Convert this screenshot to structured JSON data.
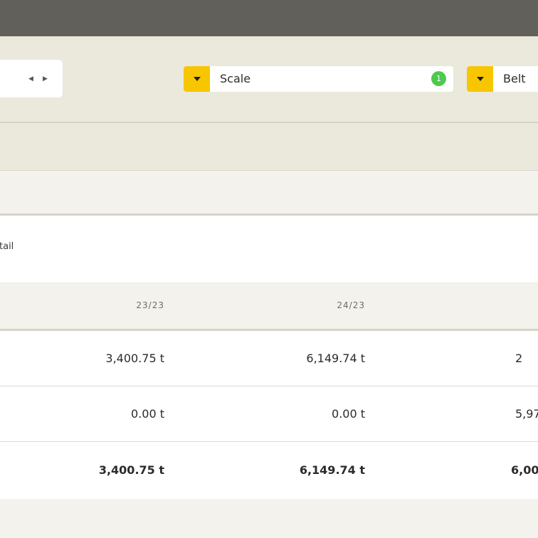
{
  "filters": {
    "scale": {
      "label": "Scale",
      "count": "1"
    },
    "belt": {
      "label": "Belt"
    }
  },
  "detail": {
    "label_partial": "tail"
  },
  "table": {
    "columns": [
      "23/23",
      "24/23",
      ""
    ],
    "rows": [
      {
        "cells": [
          "3,400.75 t",
          "6,149.74 t",
          "2"
        ]
      },
      {
        "cells": [
          "0.00 t",
          "0.00 t",
          "5,97"
        ]
      },
      {
        "cells": [
          "3,400.75 t",
          "6,149.74 t",
          "6,00"
        ],
        "bold": true
      }
    ]
  }
}
